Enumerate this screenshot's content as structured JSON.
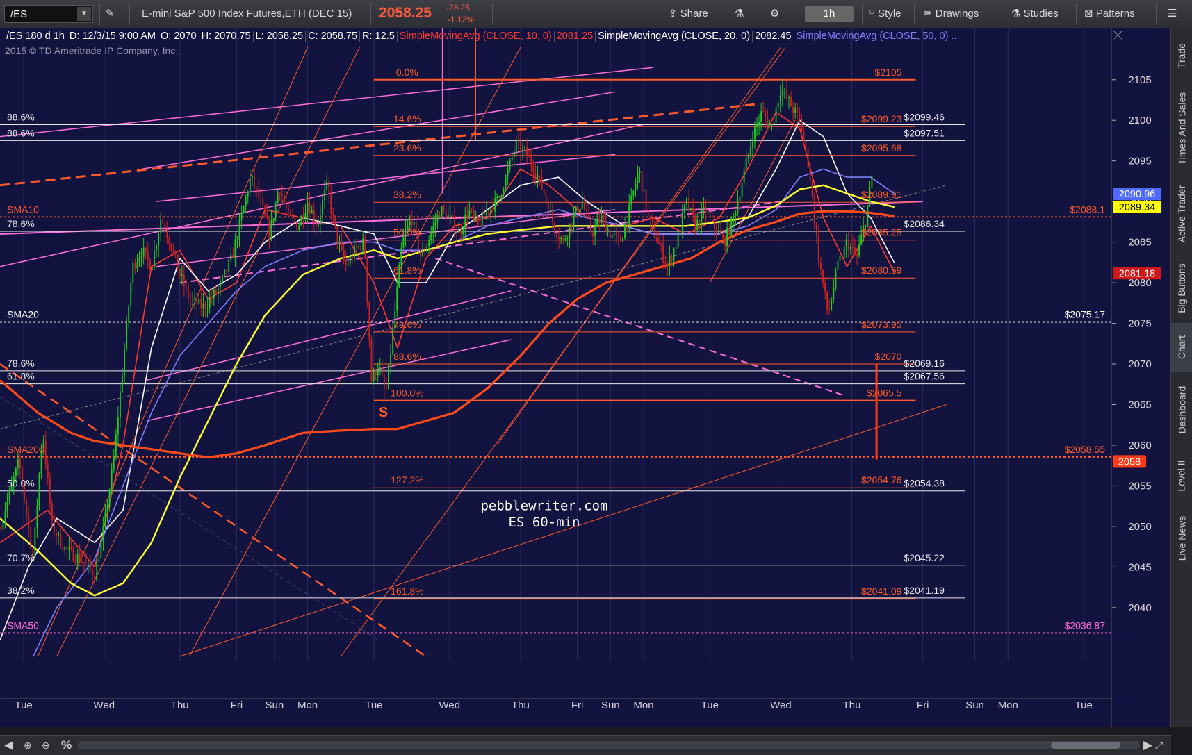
{
  "toolbar": {
    "symbol": "/ES",
    "description": "E-mini S&P 500 Index Futures,ETH (DEC 15)",
    "last": "2058.25",
    "change": "-23.25",
    "change_pct": "-1.12%",
    "share": "Share",
    "timeframe": "1h",
    "style": "Style",
    "drawings": "Drawings",
    "studies": "Studies",
    "patterns": "Patterns"
  },
  "infobar": {
    "chart": "/ES 180 d 1h",
    "date": "D: 12/3/15 9:00 AM",
    "open": "O: 2070",
    "high": "H: 2070.75",
    "low": "L: 2058.25",
    "close": "C: 2058.75",
    "range": "R: 12.5",
    "sma10": "SimpleMovingAvg (CLOSE, 10, 0)",
    "sma10_val": "2081.25",
    "sma20": "SimpleMovingAvg (CLOSE, 20, 0)",
    "sma20_val": "2082.45",
    "sma50": "SimpleMovingAvg (CLOSE, 50, 0) ..."
  },
  "copyright": "2015 © TD Ameritrade IP Company, Inc.",
  "side_tabs": [
    "Trade",
    "Times And Sales",
    "Active Trader",
    "Big Buttons",
    "Chart",
    "Dashboard",
    "Level II",
    "Live News"
  ],
  "bottom": {
    "percent": "%"
  },
  "colors": {
    "background": "#13133f",
    "price_line": "#ff4a1a",
    "fib": "#ff5a2a",
    "pink": "#ff6fd8",
    "sma_yellow": "#ffff33",
    "sma_blue": "#8080ff",
    "sma_white": "#ffffff",
    "up_candle": "#22cc22",
    "down_candle": "#cc2222"
  },
  "chart_data": {
    "type": "candlestick",
    "interval": "1h",
    "ylim": [
      2034,
      2109
    ],
    "y_ticks": [
      2040,
      2045,
      2050,
      2055,
      2060,
      2065,
      2070,
      2075,
      2080,
      2085,
      2090,
      2095,
      2100,
      2105
    ],
    "x_labels": [
      {
        "t": 0.5,
        "label": "Tue"
      },
      {
        "t": 2.2,
        "label": "Wed"
      },
      {
        "t": 3.8,
        "label": "Thu"
      },
      {
        "t": 5.0,
        "label": "Fri"
      },
      {
        "t": 5.8,
        "label": "Sun"
      },
      {
        "t": 6.5,
        "label": "Mon"
      },
      {
        "t": 7.9,
        "label": "Tue"
      },
      {
        "t": 9.5,
        "label": "Wed"
      },
      {
        "t": 11.0,
        "label": "Thu"
      },
      {
        "t": 12.2,
        "label": "Fri"
      },
      {
        "t": 12.9,
        "label": "Sun"
      },
      {
        "t": 13.6,
        "label": "Mon"
      },
      {
        "t": 15.0,
        "label": "Tue"
      },
      {
        "t": 16.5,
        "label": "Wed"
      },
      {
        "t": 18.0,
        "label": "Thu"
      },
      {
        "t": 19.5,
        "label": "Fri"
      },
      {
        "t": 20.6,
        "label": "Sun"
      },
      {
        "t": 21.3,
        "label": "Mon"
      },
      {
        "t": 22.9,
        "label": "Tue"
      }
    ],
    "xlim": [
      0,
      23.5
    ],
    "last_t": 18.45,
    "price_path": [
      [
        0,
        2050
      ],
      [
        0.4,
        2058
      ],
      [
        0.7,
        2046
      ],
      [
        0.9,
        2062
      ],
      [
        1.1,
        2050
      ],
      [
        1.4,
        2047
      ],
      [
        1.7,
        2046
      ],
      [
        2.0,
        2044
      ],
      [
        2.2,
        2050
      ],
      [
        2.4,
        2058
      ],
      [
        2.6,
        2070
      ],
      [
        2.8,
        2082
      ],
      [
        3.0,
        2084
      ],
      [
        3.2,
        2082
      ],
      [
        3.4,
        2088
      ],
      [
        3.6,
        2085
      ],
      [
        3.8,
        2081
      ],
      [
        4.0,
        2078
      ],
      [
        4.3,
        2077
      ],
      [
        4.6,
        2079
      ],
      [
        4.9,
        2083
      ],
      [
        5.1,
        2088
      ],
      [
        5.3,
        2093
      ],
      [
        5.5,
        2090
      ],
      [
        5.7,
        2086
      ],
      [
        5.9,
        2092
      ],
      [
        6.1,
        2088
      ],
      [
        6.3,
        2087
      ],
      [
        6.5,
        2090
      ],
      [
        6.7,
        2087
      ],
      [
        6.9,
        2092
      ],
      [
        7.1,
        2086
      ],
      [
        7.3,
        2082
      ],
      [
        7.5,
        2084
      ],
      [
        7.7,
        2085
      ],
      [
        7.85,
        2068
      ],
      [
        8.0,
        2070
      ],
      [
        8.15,
        2066
      ],
      [
        8.3,
        2074
      ],
      [
        8.5,
        2085
      ],
      [
        8.7,
        2088
      ],
      [
        8.9,
        2083
      ],
      [
        9.1,
        2086
      ],
      [
        9.3,
        2089
      ],
      [
        9.5,
        2088
      ],
      [
        9.7,
        2086
      ],
      [
        9.9,
        2089
      ],
      [
        10.1,
        2087
      ],
      [
        10.3,
        2089
      ],
      [
        10.5,
        2090
      ],
      [
        10.7,
        2093
      ],
      [
        10.9,
        2097
      ],
      [
        11.1,
        2096
      ],
      [
        11.3,
        2094
      ],
      [
        11.5,
        2091
      ],
      [
        11.7,
        2087
      ],
      [
        11.9,
        2085
      ],
      [
        12.1,
        2088
      ],
      [
        12.3,
        2090
      ],
      [
        12.5,
        2086
      ],
      [
        12.7,
        2088
      ],
      [
        12.9,
        2086
      ],
      [
        13.1,
        2085
      ],
      [
        13.3,
        2089
      ],
      [
        13.5,
        2094
      ],
      [
        13.7,
        2088
      ],
      [
        13.9,
        2085
      ],
      [
        14.1,
        2082
      ],
      [
        14.3,
        2085
      ],
      [
        14.5,
        2090
      ],
      [
        14.7,
        2087
      ],
      [
        14.9,
        2089
      ],
      [
        15.1,
        2087
      ],
      [
        15.3,
        2085
      ],
      [
        15.5,
        2088
      ],
      [
        15.7,
        2093
      ],
      [
        15.9,
        2098
      ],
      [
        16.1,
        2101
      ],
      [
        16.3,
        2099
      ],
      [
        16.5,
        2104
      ],
      [
        16.7,
        2102
      ],
      [
        16.9,
        2100
      ],
      [
        17.1,
        2094
      ],
      [
        17.3,
        2083
      ],
      [
        17.5,
        2076
      ],
      [
        17.7,
        2082
      ],
      [
        17.9,
        2085
      ],
      [
        18.1,
        2083
      ],
      [
        18.3,
        2088
      ],
      [
        18.45,
        2094
      ],
      [
        18.55,
        2090
      ],
      [
        18.65,
        2085
      ],
      [
        18.75,
        2072
      ],
      [
        18.85,
        2070
      ],
      [
        18.95,
        2058.25
      ]
    ],
    "sma": [
      {
        "name": "SimpleMovingAvg (CLOSE, 10, 0)",
        "color": "#ff3b2f",
        "points": [
          [
            0,
            2048
          ],
          [
            1,
            2052
          ],
          [
            2,
            2045
          ],
          [
            2.6,
            2060
          ],
          [
            3.2,
            2082
          ],
          [
            3.8,
            2084
          ],
          [
            4.4,
            2078
          ],
          [
            5.0,
            2080
          ],
          [
            5.6,
            2089
          ],
          [
            6.4,
            2088
          ],
          [
            7.2,
            2087
          ],
          [
            7.9,
            2080
          ],
          [
            8.4,
            2072
          ],
          [
            9.0,
            2083
          ],
          [
            9.6,
            2087
          ],
          [
            10.3,
            2088
          ],
          [
            11.0,
            2094
          ],
          [
            11.6,
            2092
          ],
          [
            12.4,
            2088
          ],
          [
            13.2,
            2087
          ],
          [
            13.8,
            2088
          ],
          [
            14.5,
            2086
          ],
          [
            15.2,
            2088
          ],
          [
            15.8,
            2094
          ],
          [
            16.4,
            2101
          ],
          [
            16.9,
            2099
          ],
          [
            17.4,
            2088
          ],
          [
            17.9,
            2082
          ],
          [
            18.4,
            2087
          ],
          [
            18.9,
            2081.25
          ]
        ]
      },
      {
        "name": "SimpleMovingAvg (CLOSE, 20, 0)",
        "color": "#ffffff",
        "points": [
          [
            0,
            2036
          ],
          [
            0.6,
            2045
          ],
          [
            1.2,
            2051
          ],
          [
            2.0,
            2048
          ],
          [
            2.6,
            2052
          ],
          [
            3.2,
            2072
          ],
          [
            3.8,
            2083
          ],
          [
            4.4,
            2079
          ],
          [
            5.0,
            2081
          ],
          [
            5.6,
            2085
          ],
          [
            6.4,
            2088
          ],
          [
            7.2,
            2087
          ],
          [
            7.9,
            2086
          ],
          [
            8.4,
            2080
          ],
          [
            9.0,
            2080
          ],
          [
            9.6,
            2086
          ],
          [
            10.3,
            2089
          ],
          [
            11.0,
            2092
          ],
          [
            11.8,
            2093
          ],
          [
            12.4,
            2090
          ],
          [
            13.2,
            2087
          ],
          [
            13.8,
            2086
          ],
          [
            14.5,
            2086
          ],
          [
            15.2,
            2086
          ],
          [
            15.8,
            2088
          ],
          [
            16.4,
            2094
          ],
          [
            16.9,
            2100
          ],
          [
            17.4,
            2098
          ],
          [
            17.9,
            2091
          ],
          [
            18.4,
            2088
          ],
          [
            18.9,
            2082.45
          ]
        ]
      },
      {
        "name": "SimpleMovingAvg (CLOSE, 50, 0)",
        "color": "#8080ff",
        "points": [
          [
            0.7,
            2034
          ],
          [
            1.2,
            2040
          ],
          [
            2.0,
            2046
          ],
          [
            2.6,
            2055
          ],
          [
            3.2,
            2064
          ],
          [
            3.8,
            2071
          ],
          [
            4.4,
            2075
          ],
          [
            5.0,
            2079
          ],
          [
            5.6,
            2082
          ],
          [
            6.4,
            2084
          ],
          [
            7.2,
            2085
          ],
          [
            7.9,
            2085
          ],
          [
            8.4,
            2084
          ],
          [
            9.0,
            2084
          ],
          [
            9.6,
            2085
          ],
          [
            10.3,
            2087
          ],
          [
            11.0,
            2088
          ],
          [
            11.8,
            2089
          ],
          [
            12.4,
            2088
          ],
          [
            13.2,
            2087
          ],
          [
            13.8,
            2086
          ],
          [
            14.5,
            2086
          ],
          [
            15.2,
            2086
          ],
          [
            15.8,
            2087
          ],
          [
            16.4,
            2089
          ],
          [
            16.9,
            2093
          ],
          [
            17.4,
            2094
          ],
          [
            17.9,
            2093
          ],
          [
            18.4,
            2093
          ],
          [
            18.9,
            2090.96
          ]
        ]
      },
      {
        "name": "SMA100",
        "color": "#ffff33",
        "points": [
          [
            0,
            2051
          ],
          [
            0.8,
            2047
          ],
          [
            1.5,
            2043
          ],
          [
            2.0,
            2041.5
          ],
          [
            2.6,
            2043
          ],
          [
            3.2,
            2048
          ],
          [
            3.8,
            2056
          ],
          [
            4.4,
            2063
          ],
          [
            5.0,
            2070
          ],
          [
            5.6,
            2076
          ],
          [
            6.4,
            2081
          ],
          [
            7.2,
            2083
          ],
          [
            7.9,
            2084
          ],
          [
            8.4,
            2083
          ],
          [
            9.0,
            2084
          ],
          [
            9.6,
            2085
          ],
          [
            10.3,
            2086
          ],
          [
            11.0,
            2086.5
          ],
          [
            11.8,
            2087
          ],
          [
            12.4,
            2087
          ],
          [
            13.2,
            2087
          ],
          [
            13.8,
            2087
          ],
          [
            14.5,
            2087
          ],
          [
            15.2,
            2087.5
          ],
          [
            15.8,
            2088
          ],
          [
            16.4,
            2089.5
          ],
          [
            16.9,
            2091.5
          ],
          [
            17.4,
            2092
          ],
          [
            17.9,
            2091
          ],
          [
            18.4,
            2090
          ],
          [
            18.9,
            2089.34
          ]
        ]
      },
      {
        "name": "SMA200",
        "color": "#ff4a1a",
        "points": [
          [
            0,
            2068
          ],
          [
            0.8,
            2064
          ],
          [
            1.5,
            2061.5
          ],
          [
            2.0,
            2060.5
          ],
          [
            2.6,
            2060
          ],
          [
            3.2,
            2059.5
          ],
          [
            3.8,
            2059
          ],
          [
            4.4,
            2058.5
          ],
          [
            5.0,
            2059
          ],
          [
            5.6,
            2060
          ],
          [
            6.4,
            2061.5
          ],
          [
            7.2,
            2061.8
          ],
          [
            7.9,
            2062
          ],
          [
            8.4,
            2062
          ],
          [
            9.0,
            2063
          ],
          [
            9.6,
            2064
          ],
          [
            10.3,
            2067
          ],
          [
            11.0,
            2071
          ],
          [
            11.6,
            2075
          ],
          [
            12.2,
            2078
          ],
          [
            12.8,
            2080
          ],
          [
            13.4,
            2081
          ],
          [
            14.0,
            2082
          ],
          [
            14.6,
            2083
          ],
          [
            15.2,
            2085
          ],
          [
            15.8,
            2086.5
          ],
          [
            16.4,
            2087.5
          ],
          [
            16.9,
            2088.5
          ],
          [
            17.4,
            2088.8
          ],
          [
            17.9,
            2088.8
          ],
          [
            18.4,
            2088.6
          ],
          [
            18.9,
            2088.2
          ]
        ]
      }
    ],
    "fib_levels": [
      {
        "pct": "0.0%",
        "price": 2105,
        "label": "$2105"
      },
      {
        "pct": "14.6%",
        "price": 2099.23,
        "label": "$2099.23"
      },
      {
        "pct": "23.6%",
        "price": 2095.68,
        "label": "$2095.68"
      },
      {
        "pct": "38.2%",
        "price": 2089.91,
        "label": "$2089.91"
      },
      {
        "pct": "50.0%",
        "price": 2085.25,
        "label": "$2085.25"
      },
      {
        "pct": "61.8%",
        "price": 2080.59,
        "label": "$2080.59"
      },
      {
        "pct": "78.6%",
        "price": 2073.95,
        "label": "$2073.95"
      },
      {
        "pct": "88.6%",
        "price": 2070,
        "label": "$2070"
      },
      {
        "pct": "100.0%",
        "price": 2065.5,
        "label": "$2065.5"
      },
      {
        "pct": "127.2%",
        "price": 2054.76,
        "label": "$2054.76"
      },
      {
        "pct": "161.8%",
        "price": 2041.09,
        "label": "$2041.09"
      }
    ],
    "white_levels": [
      {
        "pct": "88.6%",
        "price": 2099.46,
        "label": "$2099.46"
      },
      {
        "pct": "88.6%",
        "price": 2097.51,
        "label": "$2097.51"
      },
      {
        "pct": "78.6%",
        "price": 2086.34,
        "label": "$2086.34"
      },
      {
        "pct": "78.6%",
        "price": 2069.16,
        "label": "$2069.16"
      },
      {
        "pct": "61.8%",
        "price": 2067.56,
        "label": "$2067.56"
      },
      {
        "pct": "50.0%",
        "price": 2054.38,
        "label": "$2054.38"
      },
      {
        "pct": "70.7%",
        "price": 2045.22,
        "label": "$2045.22"
      },
      {
        "pct": "38.2%",
        "price": 2041.19,
        "label": "$2041.19"
      }
    ],
    "sma_levels": [
      {
        "label": "SMA10",
        "price": 2088.1,
        "value_label": "$2088.1",
        "color": "#ff5a2a"
      },
      {
        "label": "SMA20",
        "price": 2075.17,
        "value_label": "$2075.17",
        "color": "#ffffff"
      },
      {
        "label": "SMA200",
        "price": 2058.55,
        "value_label": "$2058.55",
        "color": "#ff5a2a"
      },
      {
        "label": "SMA50",
        "price": 2036.87,
        "value_label": "$2036.87",
        "color": "#ff6fd8"
      }
    ],
    "price_bubbles": [
      {
        "price": 2090.96,
        "label": "2090.96",
        "bg": "#4f6bff",
        "fg": "#ffffff"
      },
      {
        "price": 2089.34,
        "label": "2089.34",
        "bg": "#ffff00",
        "fg": "#000000"
      },
      {
        "price": 2081.18,
        "label": "2081.18",
        "bg": "#cc1a1a",
        "fg": "#ffffff"
      },
      {
        "price": 2058,
        "label": "2058",
        "bg": "#ff3b1a",
        "fg": "#ffffff"
      }
    ],
    "annotations": [
      {
        "text": "pebblewriter.com",
        "t": 11.5,
        "price": 2052
      },
      {
        "text": "ES 60-min",
        "t": 11.5,
        "price": 2050
      },
      {
        "text": "S",
        "t": 8.1,
        "price": 2064
      }
    ]
  }
}
